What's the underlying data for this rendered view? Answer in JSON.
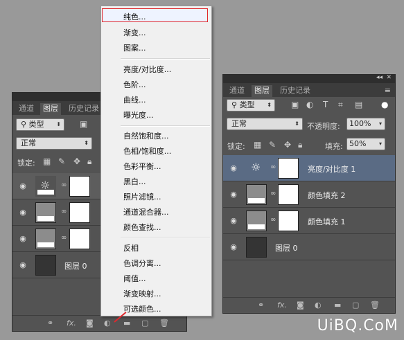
{
  "colors": {
    "accent": "#e0282e",
    "selected_layer": "#5a6b84",
    "panel": "#535353"
  },
  "left_panel": {
    "tabs": [
      "通道",
      "图层",
      "历史记录"
    ],
    "filter_value": "类型",
    "blend_mode": "正常",
    "lock_label": "锁定:",
    "layers": [
      {
        "name": "",
        "kind": "adjustment",
        "icon": "sun-icon"
      },
      {
        "name": "",
        "kind": "fill"
      },
      {
        "name": "",
        "kind": "fill"
      },
      {
        "name": "图层 0",
        "kind": "pixel"
      }
    ],
    "bottom_fx": "fx."
  },
  "right_panel": {
    "tabs": [
      "通道",
      "图层",
      "历史记录"
    ],
    "filter_value": "类型",
    "blend_mode": "正常",
    "opacity_label": "不透明度:",
    "opacity_value": "100%",
    "lock_label": "锁定:",
    "fill_label": "填充:",
    "fill_value": "50%",
    "layers": [
      {
        "name": "亮度/对比度 1",
        "kind": "adjustment",
        "selected": true
      },
      {
        "name": "颜色填充 2",
        "kind": "fill"
      },
      {
        "name": "颜色填充 1",
        "kind": "fill"
      },
      {
        "name": "图层 0",
        "kind": "pixel"
      }
    ],
    "bottom_fx": "fx."
  },
  "menu": {
    "items": [
      "纯色...",
      "渐变...",
      "图案...",
      "亮度/对比度...",
      "色阶...",
      "曲线...",
      "曝光度...",
      "自然饱和度...",
      "色相/饱和度...",
      "色彩平衡...",
      "黑白...",
      "照片滤镜...",
      "通道混合器...",
      "颜色查找...",
      "反相",
      "色调分离...",
      "阈值...",
      "渐变映射...",
      "可选颜色..."
    ],
    "highlighted": "纯色..."
  },
  "watermark": "UiBQ.CoM"
}
